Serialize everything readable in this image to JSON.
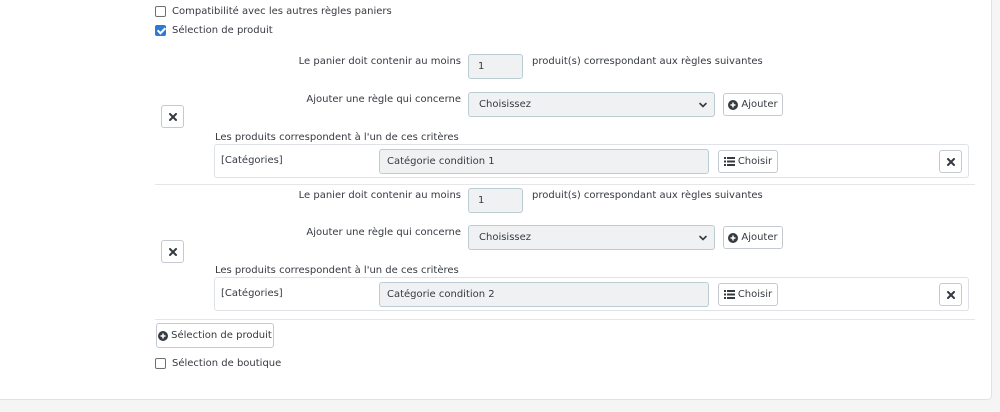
{
  "options": {
    "compatibility_label": "Compatibilité avec les autres règles paniers",
    "compatibility_checked": false,
    "product_selection_label": "Sélection de produit",
    "product_selection_checked": true,
    "shop_selection_label": "Sélection de boutique",
    "shop_selection_checked": false
  },
  "groups": [
    {
      "min_label": "Le panier doit contenir au moins",
      "min_value": "1",
      "after_label": "produit(s) correspondant aux règles suivantes",
      "add_rule_label": "Ajouter une règle qui concerne",
      "select_value": "Choisissez",
      "add_button_label": "Ajouter",
      "criteria_title": "Les produits correspondent à l'un de ces critères",
      "criteria": [
        {
          "type": "[Catégories]",
          "value": "Catégorie condition 1",
          "choose_label": "Choisir"
        }
      ]
    },
    {
      "min_label": "Le panier doit contenir au moins",
      "min_value": "1",
      "after_label": "produit(s) correspondant aux règles suivantes",
      "add_rule_label": "Ajouter une règle qui concerne",
      "select_value": "Choisissez",
      "add_button_label": "Ajouter",
      "criteria_title": "Les produits correspondent à l'un de ces critères",
      "criteria": [
        {
          "type": "[Catégories]",
          "value": "Catégorie condition 2",
          "choose_label": "Choisir"
        }
      ]
    }
  ],
  "add_product_selection_label": "Sélection de produit",
  "icons": {
    "remove": "close-icon",
    "add": "plus-circle-icon",
    "choose": "list-icon",
    "dropdown": "chevron-down-icon"
  },
  "colors": {
    "checkbox_checked": "#2b7bd6",
    "input_bg": "#eff1f2",
    "border": "#bbcdd2"
  }
}
